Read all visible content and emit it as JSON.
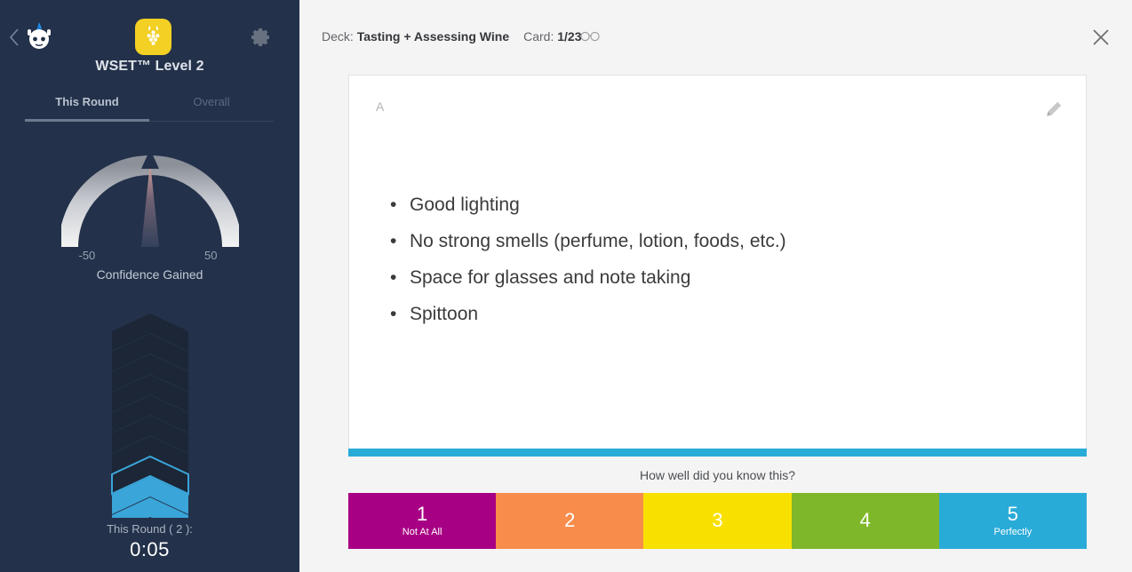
{
  "sidebar": {
    "deck_title": "WSET™ Level 2",
    "icons": {
      "back": "back-chevron-icon",
      "mascot": "mascot-robot-icon",
      "deck_logo": "grape-cluster-icon",
      "settings": "gear-icon"
    },
    "tabs": [
      {
        "label": "This Round",
        "active": true
      },
      {
        "label": "Overall",
        "active": false
      }
    ],
    "gauge": {
      "label": "Confidence Gained",
      "min_tick": "-50",
      "max_tick": "50",
      "value": 0
    },
    "chevrons": {
      "total": 10,
      "filled": 2,
      "outlined": 1,
      "fill_color": "#3aa5d9",
      "empty_color": "#1c2636"
    },
    "round": {
      "label": "This Round ( 2 ):",
      "time": "0:05"
    },
    "bg_color": "#23314a"
  },
  "header": {
    "deck_prefix": "Deck:",
    "deck_name": "Tasting + Assessing Wine",
    "card_prefix": "Card:",
    "card_position": "1/23",
    "peek_icon": "glasses-icon",
    "close_icon": "close-icon"
  },
  "card": {
    "side_label": "A",
    "edit_icon": "pencil-icon",
    "bullets": [
      "Good lighting",
      "No strong smells (perfume, lotion, foods, etc.)",
      "Space for glasses and note taking",
      "Spittoon"
    ],
    "progress_color": "#29abd8"
  },
  "rating": {
    "prompt": "How well did you know this?",
    "options": [
      {
        "num": "1",
        "sub": "Not At All",
        "color": "#a80084"
      },
      {
        "num": "2",
        "sub": "",
        "color": "#f78c4b"
      },
      {
        "num": "3",
        "sub": "",
        "color": "#f8e000"
      },
      {
        "num": "4",
        "sub": "",
        "color": "#7fb72b"
      },
      {
        "num": "5",
        "sub": "Perfectly",
        "color": "#29abd8"
      }
    ]
  }
}
